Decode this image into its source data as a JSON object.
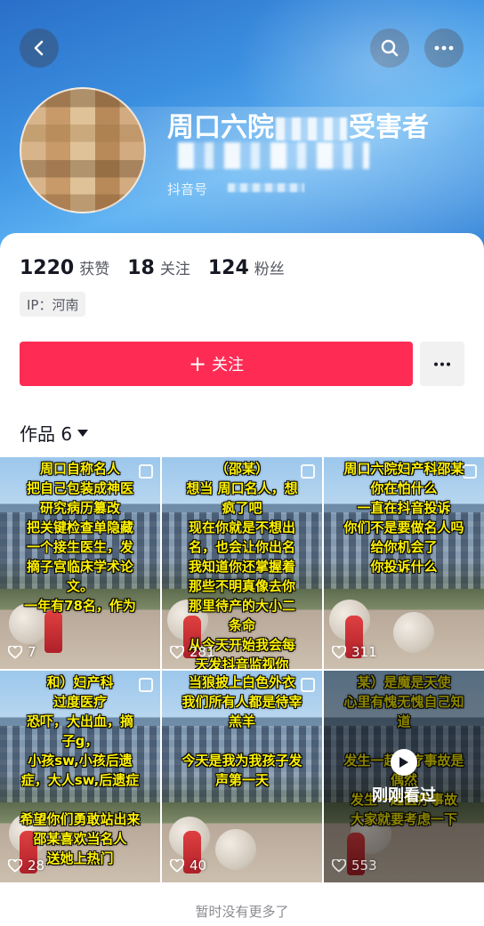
{
  "profile": {
    "nickname_start": "周口六院",
    "nickname_end": "受害者",
    "douyin_id_label": "抖音号",
    "stats": [
      {
        "value": "1220",
        "label": "获赞"
      },
      {
        "value": "18",
        "label": "关注"
      },
      {
        "value": "124",
        "label": "粉丝"
      }
    ],
    "ip_tag": "IP：河南",
    "follow_label": "关注",
    "works_tab": "作品 6"
  },
  "videos": [
    {
      "text": "周口自称名人\n把自己包装成神医\n研究病历篡改\n把关键检查单隐藏\n一个接生医生，发\n摘子宫临床学术论\n文。\n一年有78名，作为",
      "likes": "7"
    },
    {
      "text": "（邵某）\n想当 周口名人，想\n疯了吧\n现在你就是不想出\n名，也会让你出名\n我知道你还掌握着\n那些不明真像去你\n那里待产的大小二\n条命\n从今天开始我会每\n天发抖音监视你",
      "likes": "281"
    },
    {
      "text": "周口六院妇产科邵某\n你在怕什么\n一直在抖音投诉\n你们不是要做名人吗\n给你机会了\n你投诉什么",
      "likes": "311"
    },
    {
      "text": "和）妇产科\n过度医疗\n恐吓，大出血，摘\n子g，\n小孩sw,小孩后遗\n症，大人sw,后遗症\n\n希望你们勇敢站出来\n邵某喜欢当名人\n送她上热门",
      "likes": "28"
    },
    {
      "text": "当狼披上白色外衣\n我们所有人都是待宰\n羔羊\n\n今天是我为我孩子发\n声第一天",
      "likes": "40"
    },
    {
      "text": "某）是魔是天使\n心里有愧无愧自己知\n道\n\n发生一起医疗事故是\n偶然\n发生一起医疗事故\n大家就要考虑一下",
      "likes": "553",
      "seen_label": "刚刚看过"
    }
  ],
  "footer_note": "暂时没有更多了",
  "colors": {
    "accent": "#fe2c55",
    "overlay_text": "#fff200"
  }
}
